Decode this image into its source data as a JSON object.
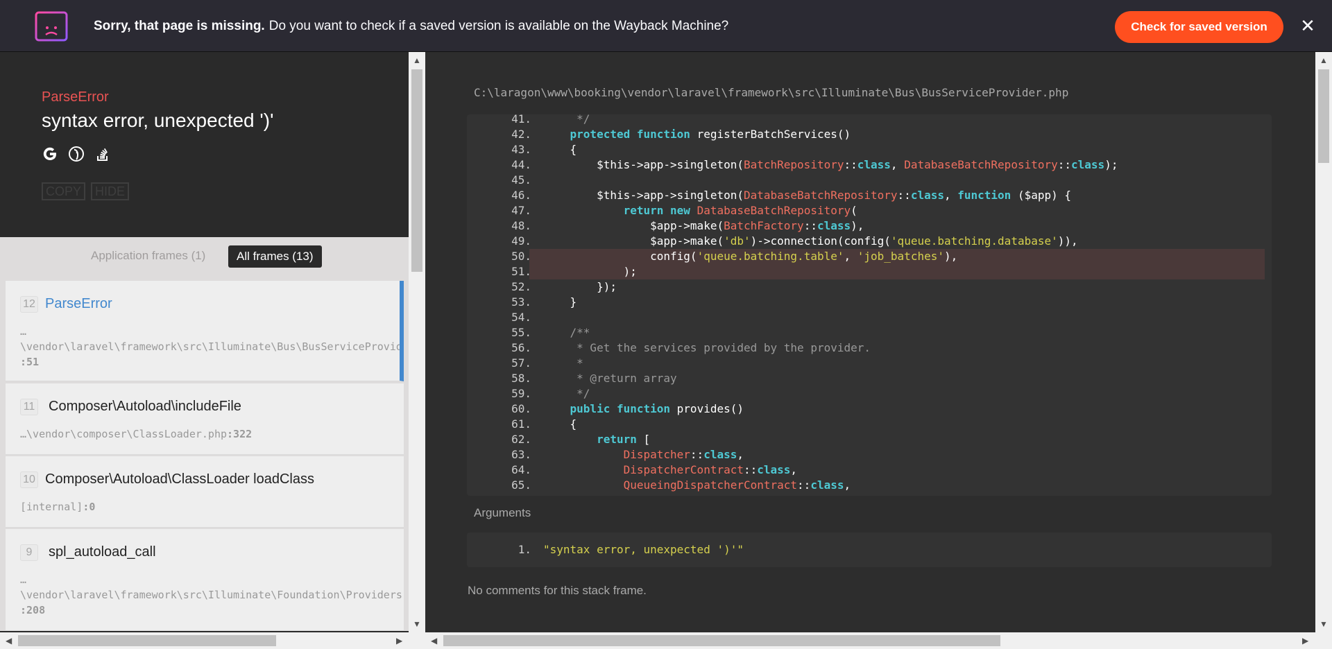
{
  "banner": {
    "bold_text": "Sorry, that page is missing.",
    "text": "Do you want to check if a saved version is available on the Wayback Machine?",
    "button_label": "Check for saved version",
    "close_label": "✕"
  },
  "error": {
    "type": "ParseError",
    "message": "syntax error, unexpected ')'",
    "copy_label": "COPY",
    "hide_label": "HIDE",
    "icons": [
      "google-icon",
      "duckduckgo-icon",
      "stackoverflow-icon"
    ]
  },
  "frames_filter": {
    "application_label": "Application frames (1)",
    "all_label": "All frames (13)"
  },
  "frames": [
    {
      "index": "12",
      "name": "ParseError",
      "path": "…\n\\vendor\\laravel\\framework\\src\\Illuminate\\Bus\\BusServiceProvider.php",
      "line": ":51",
      "active": true
    },
    {
      "index": "11",
      "name": "Composer\\Autoload\\includeFile",
      "path": "…\\vendor\\composer\\ClassLoader.php",
      "line": ":322",
      "active": false
    },
    {
      "index": "10",
      "name": "Composer\\Autoload\\ClassLoader loadClass",
      "path": "[internal]",
      "line": ":0",
      "active": false
    },
    {
      "index": "9",
      "name": "spl_autoload_call",
      "path": "…\n\\vendor\\laravel\\framework\\src\\Illuminate\\Foundation\\Providers",
      "line": ":208",
      "active": false
    }
  ],
  "file_path": "C:\\laragon\\www\\booking\\vendor\\laravel\\framework\\src\\Illuminate\\Bus\\BusServiceProvider.php",
  "code_lines": [
    {
      "n": "41.",
      "html": "<span class=\"cm\">     */</span>"
    },
    {
      "n": "42.",
      "html": "    <span class=\"kw\">protected</span> <span class=\"kw\">function</span> registerBatchServices()"
    },
    {
      "n": "43.",
      "html": "    {"
    },
    {
      "n": "44.",
      "html": "        $this->app->singleton(<span class=\"cls\">BatchRepository</span>::<span class=\"kw\">class</span>, <span class=\"cls\">DatabaseBatchRepository</span>::<span class=\"kw\">class</span>);"
    },
    {
      "n": "45.",
      "html": ""
    },
    {
      "n": "46.",
      "html": "        $this->app->singleton(<span class=\"cls\">DatabaseBatchRepository</span>::<span class=\"kw\">class</span>, <span class=\"kw\">function</span> ($app) {"
    },
    {
      "n": "47.",
      "html": "            <span class=\"kw\">return</span> <span class=\"kw\">new</span> <span class=\"cls\">DatabaseBatchRepository</span>("
    },
    {
      "n": "48.",
      "html": "                $app->make(<span class=\"cls\">BatchFactory</span>::<span class=\"kw\">class</span>),"
    },
    {
      "n": "49.",
      "html": "                $app->make(<span class=\"str\">'db'</span>)->connection(config(<span class=\"str\">'queue.batching.database'</span>)),"
    },
    {
      "n": "50.",
      "html": "                config(<span class=\"str\">'queue.batching.table'</span>, <span class=\"str\">'job_batches'</span>),",
      "hl": true
    },
    {
      "n": "51.",
      "html": "            );",
      "hl": true
    },
    {
      "n": "52.",
      "html": "        });"
    },
    {
      "n": "53.",
      "html": "    }"
    },
    {
      "n": "54.",
      "html": ""
    },
    {
      "n": "55.",
      "html": "<span class=\"cm\">    /**</span>"
    },
    {
      "n": "56.",
      "html": "<span class=\"cm\">     * Get the services provided by the provider.</span>"
    },
    {
      "n": "57.",
      "html": "<span class=\"cm\">     *</span>"
    },
    {
      "n": "58.",
      "html": "<span class=\"cm\">     * @return array</span>"
    },
    {
      "n": "59.",
      "html": "<span class=\"cm\">     */</span>"
    },
    {
      "n": "60.",
      "html": "    <span class=\"kw\">public</span> <span class=\"kw\">function</span> provides()"
    },
    {
      "n": "61.",
      "html": "    {"
    },
    {
      "n": "62.",
      "html": "        <span class=\"kw\">return</span> ["
    },
    {
      "n": "63.",
      "html": "            <span class=\"cls\">Dispatcher</span>::<span class=\"kw\">class</span>,"
    },
    {
      "n": "64.",
      "html": "            <span class=\"cls\">DispatcherContract</span>::<span class=\"kw\">class</span>,"
    },
    {
      "n": "65.",
      "html": "            <span class=\"cls\">QueueingDispatcherContract</span>::<span class=\"kw\">class</span>,"
    }
  ],
  "arguments": {
    "label": "Arguments",
    "items": [
      {
        "n": "1.",
        "value": "\"syntax error, unexpected ')'\""
      }
    ]
  },
  "comments_text": "No comments for this stack frame."
}
